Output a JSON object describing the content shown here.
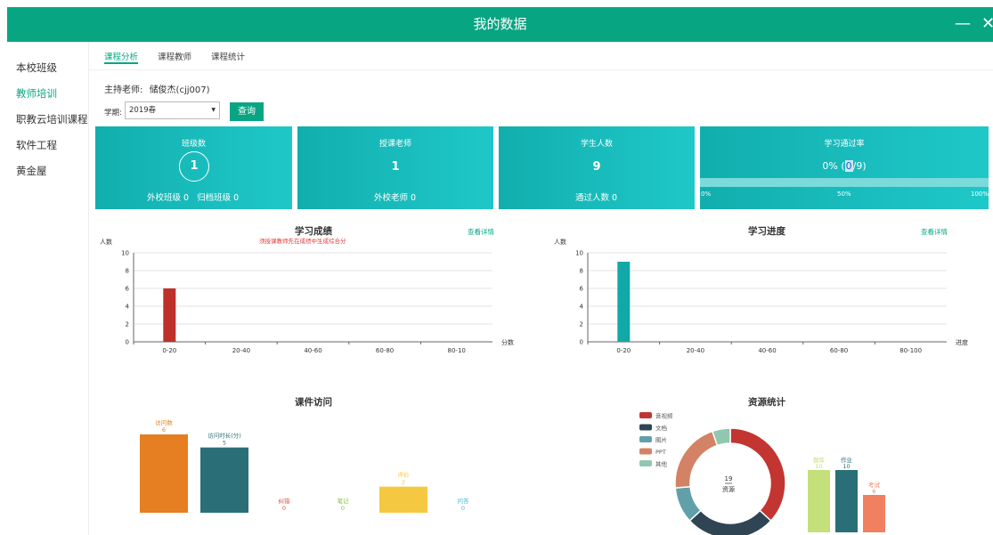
{
  "window": {
    "title": "我的数据",
    "minimize_glyph": "—",
    "close_glyph": "✕"
  },
  "sidebar": {
    "items": [
      {
        "label": "本校班级",
        "active": false
      },
      {
        "label": "教师培训",
        "active": true
      },
      {
        "label": "职教云培训课程",
        "active": false
      },
      {
        "label": "软件工程",
        "active": false
      },
      {
        "label": "黄金屋",
        "active": false
      }
    ]
  },
  "tabs": [
    {
      "label": "课程分析",
      "active": true
    },
    {
      "label": "课程教师",
      "active": false
    },
    {
      "label": "课程统计",
      "active": false
    }
  ],
  "host": {
    "label": "主持老师:",
    "name": "储俊杰(cjj007)"
  },
  "filter": {
    "term_label": "学期:",
    "term_value": "2019春",
    "query_label": "查询"
  },
  "cards": {
    "classes": {
      "title": "班级数",
      "value": "1",
      "foot1_label": "外校班级",
      "foot1_value": "0",
      "foot2_label": "归档班级",
      "foot2_value": "0"
    },
    "teachers": {
      "title": "授课老师",
      "value": "1",
      "foot_label": "外校老师",
      "foot_value": "0"
    },
    "students": {
      "title": "学生人数",
      "value": "9",
      "foot_label": "通过人数",
      "foot_value": "0"
    },
    "pass_rate": {
      "title": "学习通过率",
      "percent_text": "0%",
      "passed": "0",
      "total": "/9",
      "progress": 0,
      "ticks": [
        "0%",
        "50%",
        "100%"
      ]
    }
  },
  "panels": {
    "score": {
      "title": "学习成绩",
      "warning": "须授课教师先在成绩中生成综合分",
      "detail_link": "查看详情"
    },
    "progress": {
      "title": "学习进度",
      "detail_link": "查看详情"
    },
    "courseware": {
      "title": "课件访问"
    },
    "resources": {
      "title": "资源统计"
    }
  },
  "chart_data": [
    {
      "type": "bar",
      "title": "学习成绩",
      "ylabel": "人数",
      "xlabel": "分数",
      "ylim": [
        0,
        10
      ],
      "yticks": [
        0,
        2,
        4,
        6,
        8,
        10
      ],
      "categories": [
        "0-20",
        "20-40",
        "40-60",
        "60-80",
        "80-10"
      ],
      "values": [
        6,
        0,
        0,
        0,
        0
      ],
      "color": "#c0302b"
    },
    {
      "type": "bar",
      "title": "学习进度",
      "ylabel": "人数",
      "xlabel": "进度",
      "ylim": [
        0,
        10
      ],
      "yticks": [
        0,
        2,
        4,
        6,
        8,
        10
      ],
      "categories": [
        "0-20",
        "20-40",
        "40-60",
        "60-80",
        "80-100"
      ],
      "values": [
        9,
        0,
        0,
        0,
        0
      ],
      "color": "#13a8a8"
    },
    {
      "type": "bar",
      "title": "课件访问",
      "categories": [
        "访问数",
        "访问时长(分)",
        "纠错",
        "笔记",
        "评价",
        "问答"
      ],
      "values": [
        6,
        5,
        0,
        0,
        2,
        0
      ],
      "colors": [
        "#e67e22",
        "#2a6f77",
        "#e74c3c",
        "#8bc34a",
        "#f5c842",
        "#3db6d8"
      ]
    },
    {
      "type": "pie",
      "title": "资源统计",
      "center_total": "19",
      "center_label": "资源",
      "legend": [
        "音视频",
        "文档",
        "图片",
        "PPT",
        "其他"
      ],
      "values": [
        7,
        5,
        2,
        4,
        1
      ],
      "colors": [
        "#c23531",
        "#2f4554",
        "#61a0a8",
        "#d48265",
        "#91c7ae"
      ]
    },
    {
      "type": "bar",
      "title": "资源统计",
      "categories": [
        "题库",
        "作业",
        "考试"
      ],
      "values": [
        10,
        10,
        6
      ],
      "colors": [
        "#c4e07a",
        "#2a6f77",
        "#f08060"
      ]
    }
  ]
}
